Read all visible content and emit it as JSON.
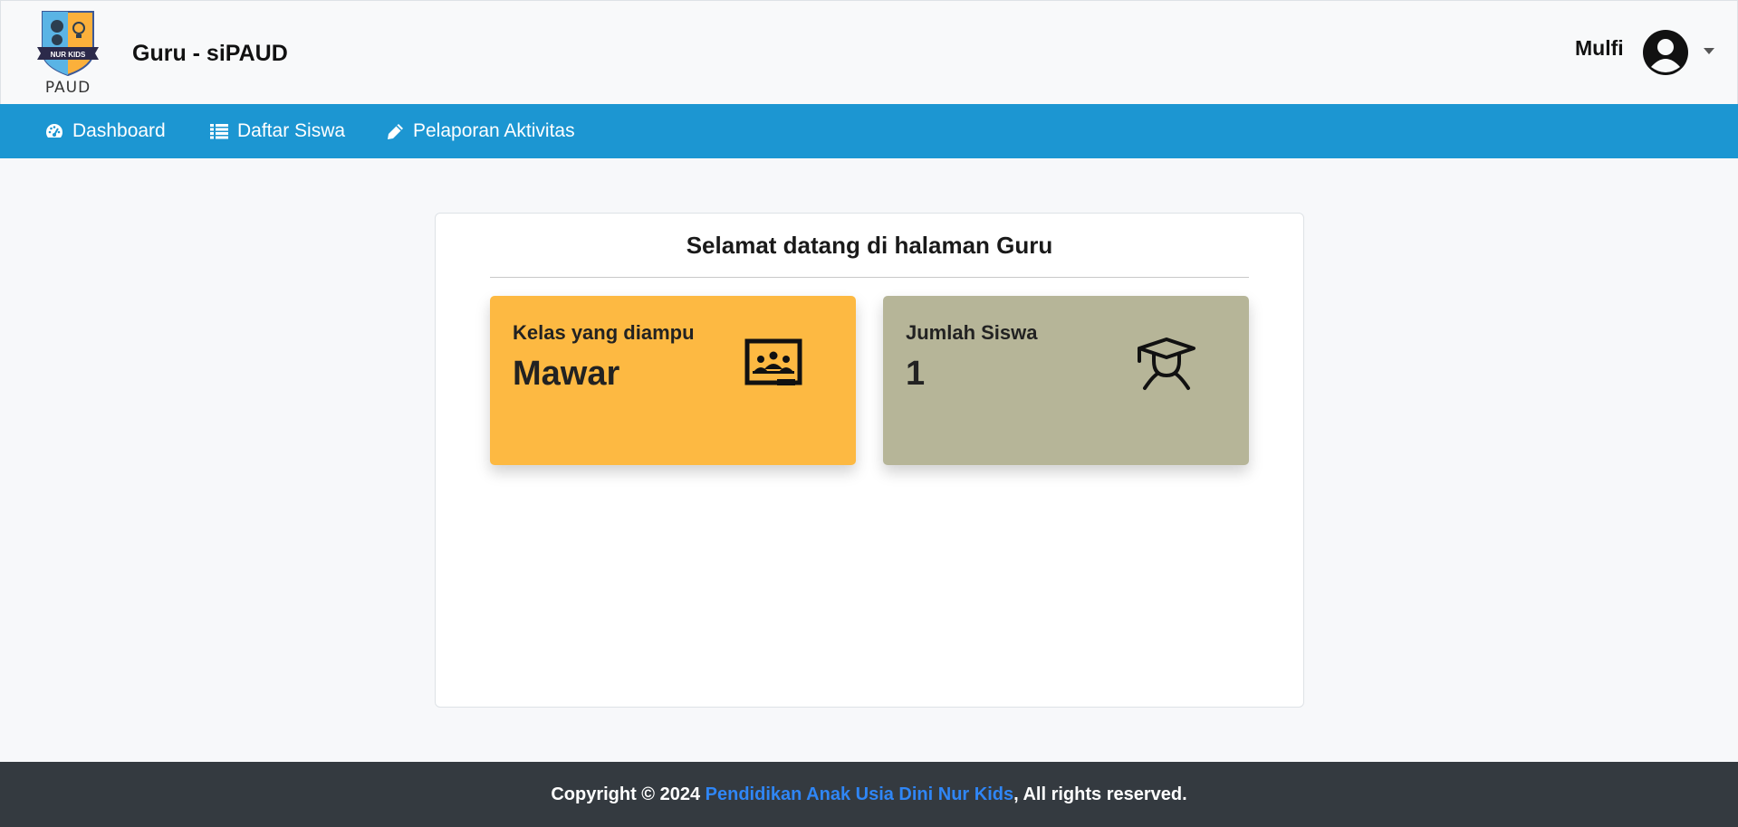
{
  "header": {
    "logo_badge_text": "NUR KIDS",
    "logo_text": "PAUD",
    "app_title": "Guru - siPAUD",
    "user_name": "Mulfi"
  },
  "nav": {
    "items": [
      {
        "label": "Dashboard",
        "icon": "tachometer-icon"
      },
      {
        "label": "Daftar Siswa",
        "icon": "list-icon"
      },
      {
        "label": "Pelaporan Aktivitas",
        "icon": "pencil-icon"
      }
    ]
  },
  "main": {
    "welcome_title": "Selamat datang di halaman Guru",
    "cards": [
      {
        "label": "Kelas yang diampu",
        "value": "Mawar",
        "icon": "classroom-icon",
        "color": "#fdb942"
      },
      {
        "label": "Jumlah Siswa",
        "value": "1",
        "icon": "graduate-student-icon",
        "color": "#b6b598"
      }
    ]
  },
  "footer": {
    "prefix": "Copyright © 2024 ",
    "link_text": "Pendidikan Anak Usia Dini Nur Kids",
    "suffix": ", All rights reserved."
  },
  "colors": {
    "nav_bg": "#1c96d2",
    "footer_bg": "#343a40",
    "link": "#2f86f6"
  }
}
